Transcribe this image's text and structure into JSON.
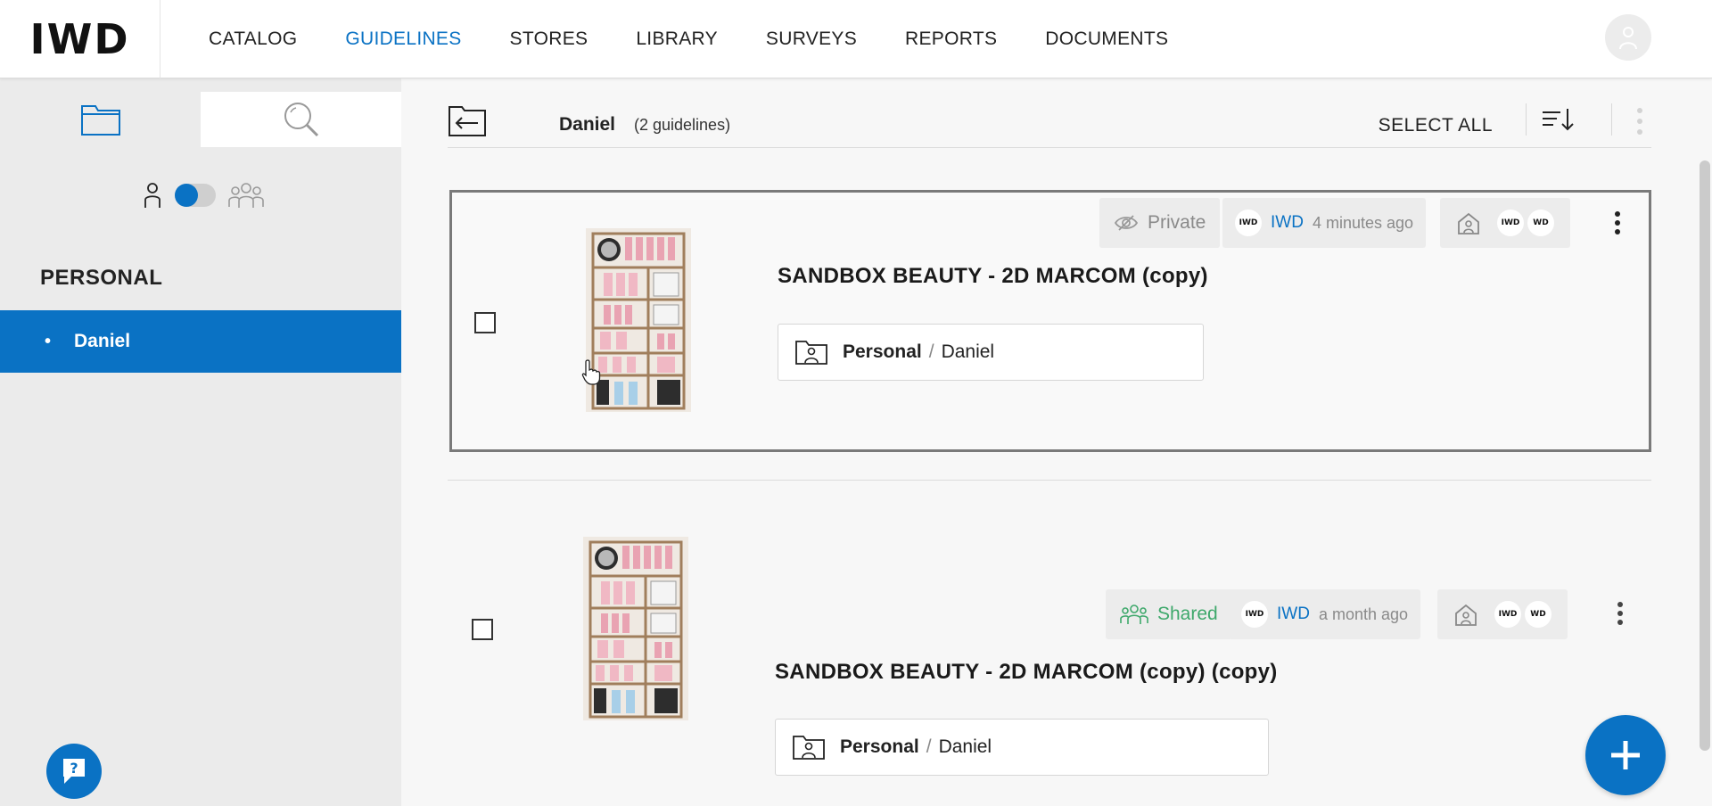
{
  "app": {
    "logo": "IWD"
  },
  "nav": {
    "items": [
      "CATALOG",
      "GUIDELINES",
      "STORES",
      "LIBRARY",
      "SURVEYS",
      "REPORTS",
      "DOCUMENTS"
    ],
    "active": "GUIDELINES"
  },
  "sidebar": {
    "section_title": "PERSONAL",
    "items": [
      {
        "label": "Daniel",
        "selected": true
      }
    ]
  },
  "folder": {
    "name": "Daniel",
    "count_label": "(2 guidelines)",
    "select_all_label": "SELECT ALL"
  },
  "guidelines": [
    {
      "title": "SANDBOX BEAUTY - 2D MARCOM (copy)",
      "visibility": "Private",
      "owner": "IWD",
      "time": "4 minutes ago",
      "path_root": "Personal",
      "path_sep": "/",
      "path_leaf": "Daniel"
    },
    {
      "title": "SANDBOX BEAUTY - 2D MARCOM (copy) (copy)",
      "visibility": "Shared",
      "owner": "IWD",
      "time": "a month ago",
      "path_root": "Personal",
      "path_sep": "/",
      "path_leaf": "Daniel"
    }
  ],
  "store_logos": [
    "IWD",
    "WD"
  ],
  "colors": {
    "accent": "#0a72c4",
    "shared": "#3ea86b",
    "muted": "#8a8a8a"
  }
}
